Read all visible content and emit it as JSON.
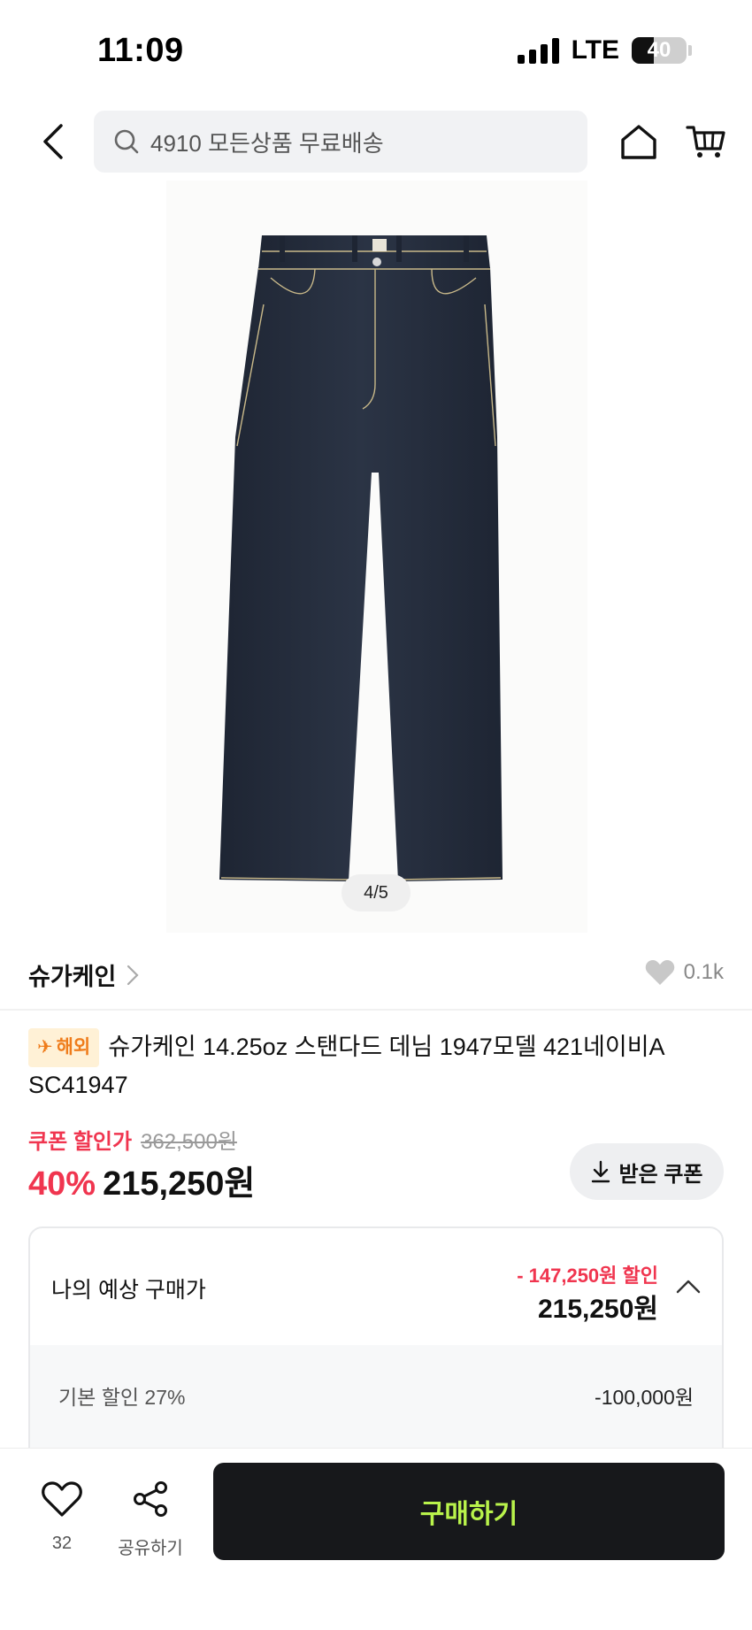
{
  "status_bar": {
    "time": "11:09",
    "network": "LTE",
    "battery": "40",
    "battery_level": 0.4
  },
  "header": {
    "search_placeholder": "4910 모든상품 무료배송",
    "icons": {
      "back": "chevron-left-icon",
      "search": "search-icon",
      "home": "home-icon",
      "cart": "cart-icon"
    }
  },
  "product": {
    "image_counter": "4/5",
    "image_subject": "jeans",
    "colors": {
      "denim": "#2b3445",
      "denim_dark": "#1e2533",
      "stitch": "#c9b98a"
    }
  },
  "brand": {
    "name": "슈가케인",
    "like_count": "0.1k"
  },
  "title": {
    "badge": "해외",
    "text": "슈가케인 14.25oz 스탠다드 데님 1947모델 421네이비A SC41947"
  },
  "price": {
    "coupon_label": "쿠폰 할인가",
    "original_price": "362,500원",
    "discount_rate": "40%",
    "sale_price": "215,250원",
    "coupon_button_label": "받은 쿠폰"
  },
  "estimate": {
    "label": "나의 예상 구매가",
    "discount_text": "- 147,250원 할인",
    "price": "215,250원",
    "lines": [
      {
        "label": "기본 할인 27%",
        "value": "-100,000원"
      }
    ]
  },
  "bottom_bar": {
    "wish_count": "32",
    "share_label": "공유하기",
    "buy_label": "구매하기"
  },
  "colors": {
    "accent_red": "#f0354f",
    "buy_text": "#b9f34b",
    "buy_bg": "#17181b"
  }
}
